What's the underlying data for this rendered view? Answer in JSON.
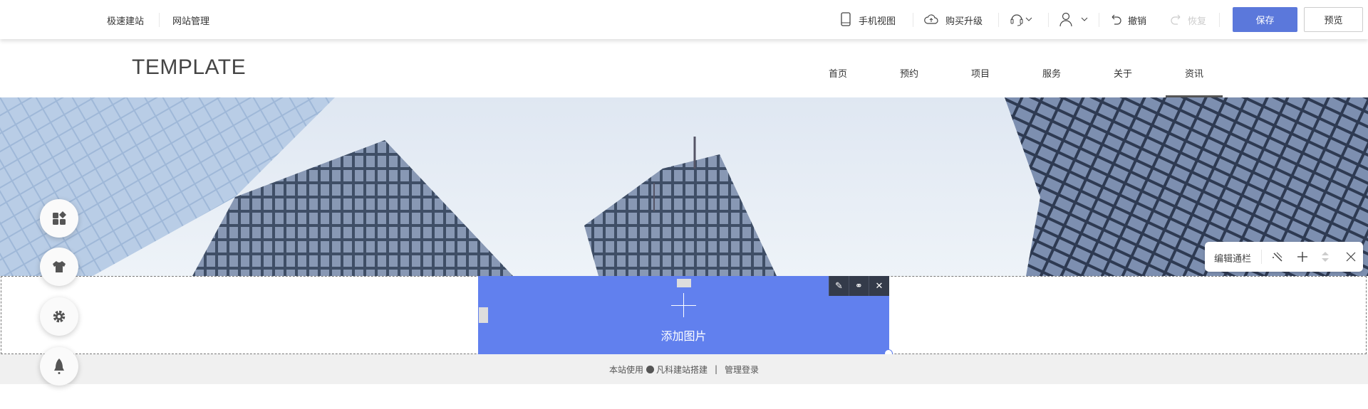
{
  "topbar": {
    "left_links": [
      "极速建站",
      "网站管理"
    ],
    "mobile_view": "手机视图",
    "upgrade": "购买升级",
    "undo": "撤销",
    "redo": "恢复",
    "save": "保存",
    "preview": "预览"
  },
  "site": {
    "logo": "TEMPLATE",
    "nav": [
      "首页",
      "预约",
      "项目",
      "服务",
      "关于",
      "资讯"
    ],
    "active_nav": "资讯"
  },
  "editor": {
    "add_image": "添加图片",
    "strip_toolbar_label": "编辑通栏"
  },
  "footer": {
    "powered_prefix": "本站使用",
    "powered_brand": "凡科建站搭建",
    "separator": "|",
    "admin_login": "管理登录"
  },
  "colors": {
    "accent": "#5b78db",
    "image_box": "#6180ee",
    "toolbar_dark": "#343b4a"
  }
}
